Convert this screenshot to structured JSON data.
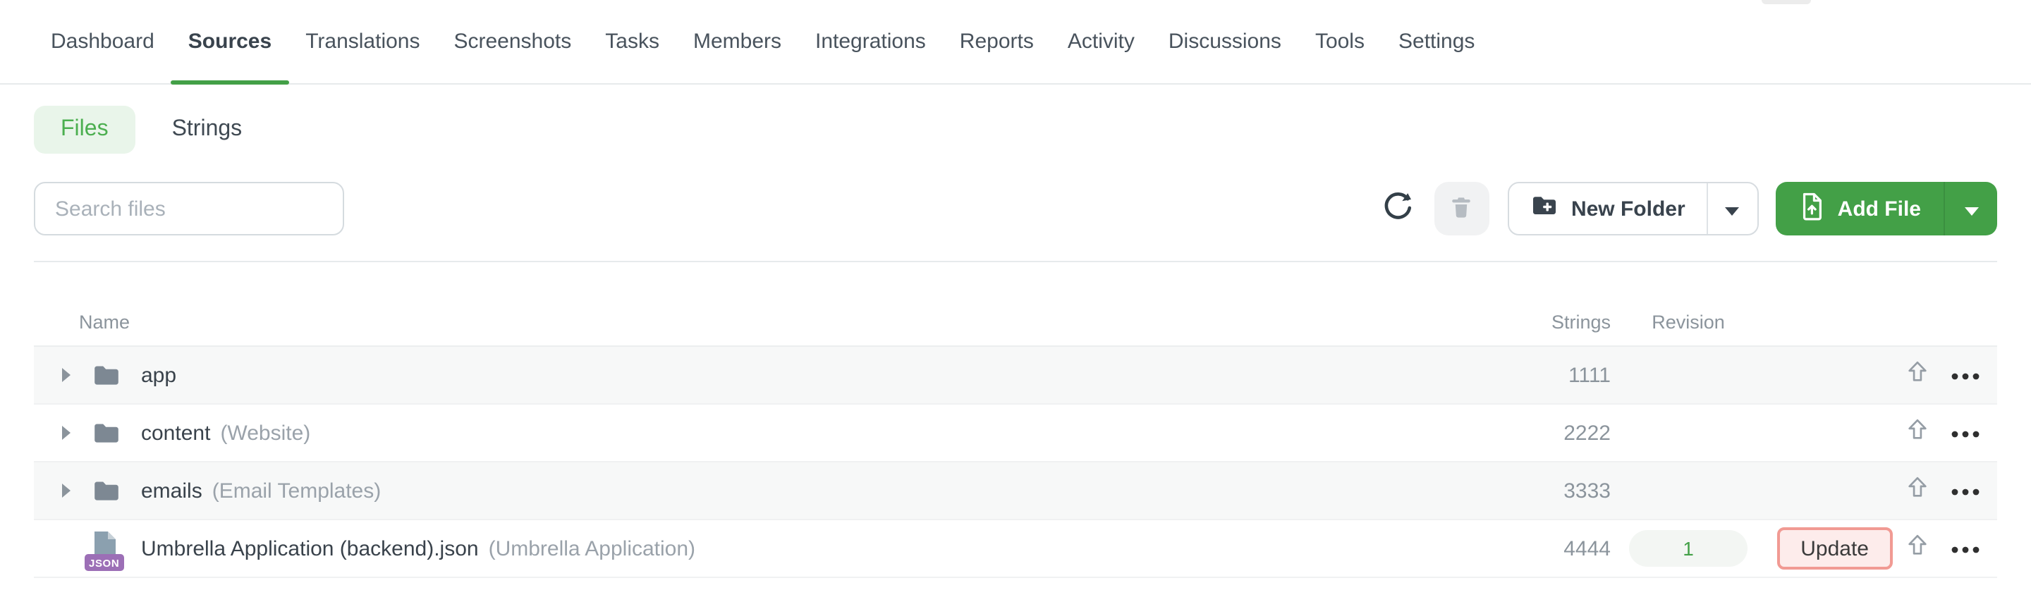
{
  "nav": {
    "active": "Sources",
    "items": [
      {
        "label": "Dashboard"
      },
      {
        "label": "Sources"
      },
      {
        "label": "Translations"
      },
      {
        "label": "Screenshots"
      },
      {
        "label": "Tasks"
      },
      {
        "label": "Members"
      },
      {
        "label": "Integrations"
      },
      {
        "label": "Reports"
      },
      {
        "label": "Activity"
      },
      {
        "label": "Discussions"
      },
      {
        "label": "Tools"
      },
      {
        "label": "Settings"
      }
    ]
  },
  "view_toggle": {
    "files_label": "Files",
    "strings_label": "Strings",
    "active": "Files"
  },
  "search": {
    "placeholder": "Search files"
  },
  "toolbar": {
    "new_folder_label": "New Folder",
    "add_file_label": "Add File"
  },
  "table": {
    "headers": {
      "name": "Name",
      "strings": "Strings",
      "revision": "Revision"
    },
    "rows": [
      {
        "kind": "folder",
        "name": "app",
        "strings": "1111"
      },
      {
        "kind": "folder",
        "name": "content",
        "subtitle": "(Website)",
        "strings": "2222"
      },
      {
        "kind": "folder",
        "name": "emails",
        "subtitle": "(Email Templates)",
        "strings": "3333"
      },
      {
        "kind": "file",
        "file_type_badge": "JSON",
        "name": "Umbrella Application (backend).json",
        "subtitle": "(Umbrella Application)",
        "strings": "4444",
        "revision": "1",
        "update_label": "Update"
      }
    ]
  },
  "icons": {
    "expand_caret": "▸",
    "dropdown_caret": "▼",
    "upload_arrow": "⇧",
    "more": "•••"
  },
  "colors": {
    "accent_green": "#43a047",
    "files_pill_bg": "#e9f5ea",
    "files_pill_text": "#4caf50",
    "row_alt_bg": "#f7f8f8",
    "revision_badge_bg": "#f3f6f3",
    "revision_badge_text": "#43a047",
    "update_button_bg": "#fdeceb",
    "update_button_border": "#f19a93",
    "json_badge_bg": "#9c6fb6",
    "folder_icon": "#7d8893",
    "header_text": "#8b949c"
  }
}
